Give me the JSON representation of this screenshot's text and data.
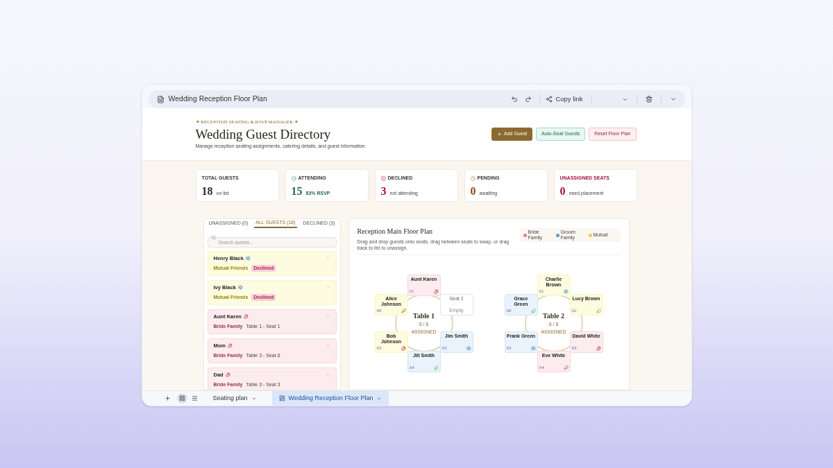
{
  "doc_bar": {
    "title": "Wedding Reception Floor Plan",
    "copy_link": "Copy link"
  },
  "header": {
    "eyebrow": "✦ RECEPTION SEATING & RSVP MANAGER ✦",
    "title": "Wedding Guest Directory",
    "subtitle": "Manage reception seating assignments, catering details, and guest information.",
    "buttons": [
      {
        "label": "Add Guest",
        "kind": "primary"
      },
      {
        "label": "Auto-Seat Guests",
        "kind": "mint"
      },
      {
        "label": "Reset Floor Plan",
        "kind": "rose"
      }
    ]
  },
  "stats": [
    {
      "label": "TOTAL GUESTS",
      "value": "18",
      "sub": "on list",
      "kind": "plain",
      "color": "#2b2b2b"
    },
    {
      "label": "ATTENDING",
      "value": "15",
      "sub": "83% RSVP",
      "kind": "check",
      "color": "#1f6b4a"
    },
    {
      "label": "DECLINED",
      "value": "3",
      "sub": "not attending",
      "kind": "cross",
      "color": "#a3123f"
    },
    {
      "label": "PENDING",
      "value": "0",
      "sub": "awaiting",
      "kind": "clock",
      "color": "#8a4a12"
    },
    {
      "label": "UNASSIGNED SEATS",
      "value": "0",
      "sub": "need placement",
      "kind": "alert",
      "color": "#a3123f"
    }
  ],
  "list_tabs": [
    {
      "label": "UNASSIGNED (0)",
      "selected": false
    },
    {
      "label": "ALL GUESTS (18)",
      "selected": true
    },
    {
      "label": "DECLINED (3)",
      "selected": false
    }
  ],
  "search": {
    "placeholder": "Search guests..."
  },
  "guests": [
    {
      "name": "Henry Black",
      "color": "#fdfbe0",
      "kind": "fish",
      "tag": "Mutual Friends",
      "detail": {
        "kind": "badge",
        "text": "Declined"
      }
    },
    {
      "name": "Ivy Black",
      "color": "#fdfbe0",
      "kind": "fish",
      "tag": "Mutual Friends",
      "detail": {
        "kind": "badge",
        "text": "Declined"
      }
    },
    {
      "name": "Aunt Karen",
      "color": "#fdecef",
      "kind": "beef",
      "tag": "Bride Family",
      "detail": {
        "kind": "plain",
        "text": "Table 1 - Seat 1"
      }
    },
    {
      "name": "Mom",
      "color": "#fdecef",
      "kind": "beef",
      "tag": "Bride Family",
      "detail": {
        "kind": "plain",
        "text": "Table 3 - Seat 6"
      }
    },
    {
      "name": "Dad",
      "color": "#fdecef",
      "kind": "beef",
      "tag": "Bride Family",
      "detail": {
        "kind": "plain",
        "text": "Table 3 - Seat 3"
      }
    }
  ],
  "floor": {
    "title": "Reception Main Floor Plan",
    "hint": "Drag and drop guests onto seats, drag between seats to swap, or drag back to list to unassign.",
    "legend": [
      {
        "label": "Bride Family",
        "color": "#ec6fa8"
      },
      {
        "label": "Groom Family",
        "color": "#5b9bd5"
      },
      {
        "label": "Mutual",
        "color": "#f2c84b"
      }
    ],
    "tables": [
      {
        "name": "Table 1",
        "count": "5 / 6",
        "status": "ASSIGNED",
        "seats": [
          {
            "name": "Aunt Karen",
            "seat": "S1",
            "color": "#fdecef",
            "kind": "beef"
          },
          {
            "name": "Alice Johnson",
            "seat": "S6",
            "color": "#fdfbe0",
            "kind": "chicken"
          },
          {
            "name": "Seat 2",
            "seat": "Empty",
            "kind": "empty"
          },
          {
            "name": "Bob Johnson",
            "seat": "S5",
            "color": "#fdfbe0",
            "kind": "beef"
          },
          {
            "name": "Jim Smith",
            "seat": "S3",
            "color": "#eaf3fb",
            "kind": "fish"
          },
          {
            "name": "Jill Smith",
            "seat": "S4",
            "color": "#eaf3fb",
            "kind": "veg"
          }
        ]
      },
      {
        "name": "Table 2",
        "count": "6 / 6",
        "status": "ASSIGNED",
        "seats": [
          {
            "name": "Charlie Brown",
            "seat": "S1",
            "color": "#fdfbe0",
            "kind": "fish"
          },
          {
            "name": "Grace Green",
            "seat": "S6",
            "color": "#eaf3fb",
            "kind": "veg"
          },
          {
            "name": "Lucy Brown",
            "seat": "S2",
            "color": "#fdfbe0",
            "kind": "veg"
          },
          {
            "name": "Frank Green",
            "seat": "S5",
            "color": "#eaf3fb",
            "kind": "fish"
          },
          {
            "name": "David White",
            "seat": "S3",
            "color": "#fdecef",
            "kind": "beef"
          },
          {
            "name": "Eve White",
            "seat": "S4",
            "color": "#fdecef",
            "kind": "chicken"
          }
        ]
      }
    ]
  },
  "sheet_tabs": [
    {
      "label": "Seating plan",
      "selected": false
    },
    {
      "label": "Wedding Reception Floor Plan",
      "selected": true
    }
  ]
}
